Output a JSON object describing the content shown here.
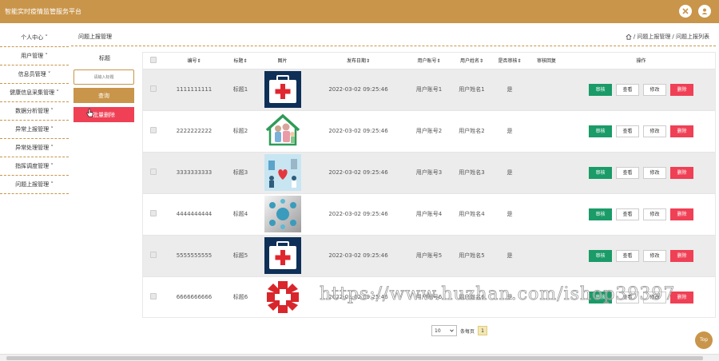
{
  "header": {
    "app_title": "智能实时疫情监管服务平台"
  },
  "sidebar": {
    "items": [
      {
        "label": "个人中心 ˅"
      },
      {
        "label": "用户管理 ˅"
      },
      {
        "label": "信息员管理 ˅"
      },
      {
        "label": "健康信息采集管理 ˅"
      },
      {
        "label": "数据分析管理 ˅"
      },
      {
        "label": "异常上报管理 ˅"
      },
      {
        "label": "异常处理管理 ˅"
      },
      {
        "label": "指挥调度管理 ˅"
      },
      {
        "label": "问题上报管理 ˅"
      }
    ]
  },
  "page": {
    "title": "问题上报管理",
    "breadcrumb_1": "/ 问题上报管理",
    "breadcrumb_2": "/ 问题上报列表"
  },
  "search": {
    "label": "标题",
    "placeholder": "请输入标题",
    "query_label": "查询",
    "batch_delete_label": "批量删除"
  },
  "table": {
    "columns": [
      "编号⇕",
      "标题⇕",
      "图片",
      "发布日期⇕",
      "用户账号⇕",
      "用户姓名⇕",
      "是否审核⇕",
      "审核回复",
      "操作"
    ],
    "actions": {
      "review": "审核",
      "view": "查看",
      "edit": "修改",
      "delete": "删除"
    },
    "rows": [
      {
        "id": "1111111111",
        "title": "标题1",
        "image": "medical-kit",
        "date": "2022-03-02 09:25:46",
        "account": "用户账号1",
        "name": "用户姓名1",
        "reviewed": "是",
        "reply": ""
      },
      {
        "id": "2222222222",
        "title": "标题2",
        "image": "family-home",
        "date": "2022-03-02 09:25:46",
        "account": "用户账号2",
        "name": "用户姓名2",
        "reviewed": "是",
        "reply": ""
      },
      {
        "id": "3333333333",
        "title": "标题3",
        "image": "hospital-care",
        "date": "2022-03-02 09:25:46",
        "account": "用户账号3",
        "name": "用户姓名3",
        "reviewed": "是",
        "reply": ""
      },
      {
        "id": "4444444444",
        "title": "标题4",
        "image": "medical-icons",
        "date": "2022-03-02 09:25:46",
        "account": "用户账号4",
        "name": "用户姓名4",
        "reviewed": "是",
        "reply": ""
      },
      {
        "id": "5555555555",
        "title": "标题5",
        "image": "medical-kit",
        "date": "2022-03-02 09:25:46",
        "account": "用户账号5",
        "name": "用户姓名5",
        "reviewed": "是",
        "reply": ""
      },
      {
        "id": "6666666666",
        "title": "标题6",
        "image": "red-cross",
        "date": "2022-03-02 09:25:46",
        "account": "用户账号6",
        "name": "用户姓名6",
        "reviewed": "是",
        "reply": ""
      }
    ]
  },
  "pagination": {
    "page_size": "10",
    "per_page_label": "条每页",
    "current_page": "1"
  },
  "top_button": "Top",
  "watermark": "https://www.huzhan.com/ishop39397",
  "colors": {
    "brand": "#c9954a",
    "green": "#1a9b68",
    "red": "#ef4055"
  }
}
